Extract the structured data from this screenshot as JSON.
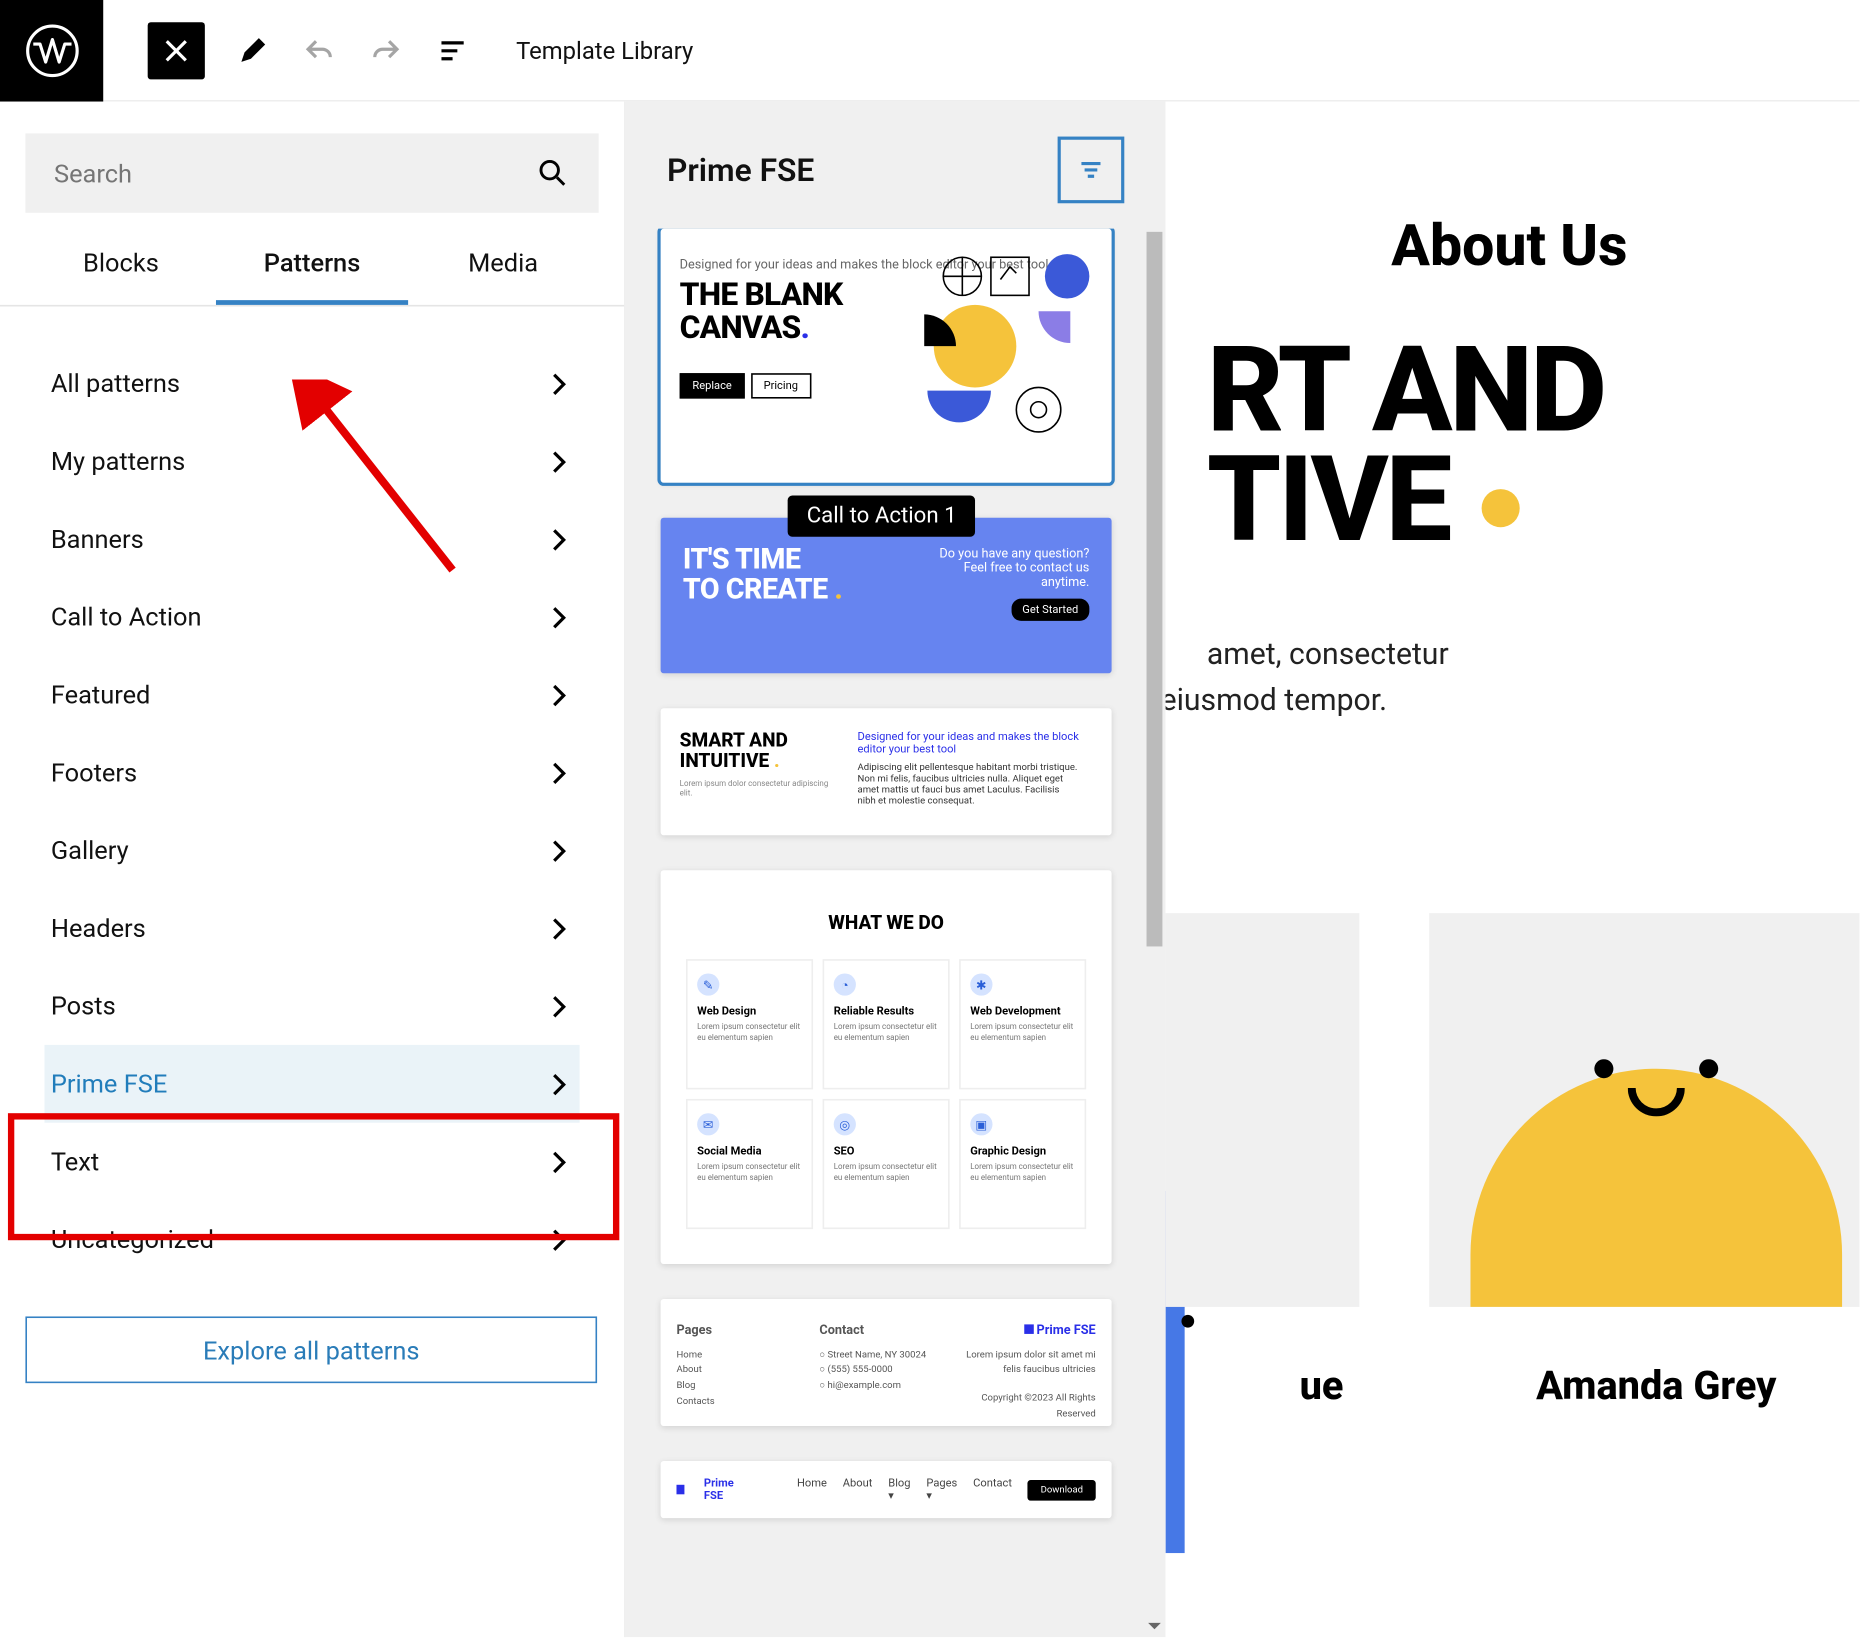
{
  "topbar": {
    "title": "Template Library"
  },
  "search": {
    "placeholder": "Search"
  },
  "tabs": {
    "blocks": "Blocks",
    "patterns": "Patterns",
    "media": "Media"
  },
  "categories": [
    "All patterns",
    "My patterns",
    "Banners",
    "Call to Action",
    "Featured",
    "Footers",
    "Gallery",
    "Headers",
    "Posts",
    "Prime FSE",
    "Text",
    "Uncategorized"
  ],
  "explore": "Explore all patterns",
  "midpanel": {
    "title": "Prime FSE",
    "tooltip": "Call to Action 1"
  },
  "p1": {
    "tag": "Designed for your ideas and makes the block editor your best tool",
    "heading_a": "THE BLANK",
    "heading_b": "CANVAS",
    "btn1": "Replace",
    "btn2": "Pricing"
  },
  "p2": {
    "heading_a": "IT'S TIME",
    "heading_b": "TO CREATE ",
    "copy": "Do you have any question? Feel free to contact us anytime.",
    "cta": "Get Started"
  },
  "p3": {
    "heading_a": "SMART AND",
    "heading_b": "INTUITIVE ",
    "blueline": "Designed for your ideas and makes the block editor your best tool",
    "body": "Adipiscing elit pellentesque habitant morbi tristique. Non mi felis, faucibus ultricies nulla. Aliquet eget amet mattis ut fauci bus amet Laculus. Facilisis nibh et molestie consequat."
  },
  "p4": {
    "title": "WHAT WE DO",
    "items": [
      {
        "icon": "✎",
        "t": "Web Design",
        "s": "Lorem ipsum consectetur elit eu elementum sapien"
      },
      {
        "icon": "◔",
        "t": "Reliable Results",
        "s": "Lorem ipsum consectetur elit eu elementum sapien"
      },
      {
        "icon": "✱",
        "t": "Web Development",
        "s": "Lorem ipsum consectetur elit eu elementum sapien"
      },
      {
        "icon": "✉",
        "t": "Social Media",
        "s": "Lorem ipsum consectetur elit eu elementum sapien"
      },
      {
        "icon": "◎",
        "t": "SEO",
        "s": "Lorem ipsum consectetur elit eu elementum sapien"
      },
      {
        "icon": "▣",
        "t": "Graphic Design",
        "s": "Lorem ipsum consectetur elit eu elementum sapien"
      }
    ]
  },
  "p5": {
    "col1_h": "Pages",
    "col1": [
      "Home",
      "About",
      "Blog",
      "Contacts"
    ],
    "col2_h": "Contact",
    "col2": [
      "Street Name, NY 30024",
      "(555) 555-0000",
      "hi@example.com"
    ],
    "brand": "Prime FSE",
    "col3a": "Lorem ipsum dolor sit amet mi felis faucibus ultricies",
    "col3b": "Copyright ©2023 All Rights Reserved"
  },
  "p6": {
    "brand": "Prime FSE",
    "nav": [
      "Home",
      "About",
      "Blog ▾",
      "Pages ▾",
      "Contact"
    ],
    "dl": "Download"
  },
  "canvas": {
    "about": "About Us",
    "h1a": "RT AND",
    "h1b": "TIVE ",
    "p1": "amet, consectetur",
    "p2": "eiusmod tempor.",
    "card1_partial": "ue",
    "card2": "Amanda Grey"
  }
}
